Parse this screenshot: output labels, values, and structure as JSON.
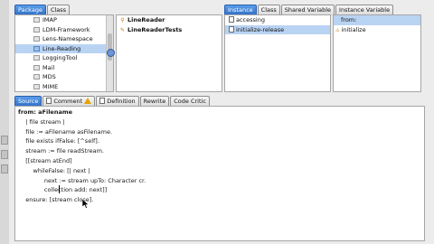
{
  "top_tabs_left": {
    "tabs": [
      {
        "label": "Package",
        "active": true
      },
      {
        "label": "Class",
        "active": false
      }
    ]
  },
  "packages": [
    {
      "label": "IMAP",
      "selected": false
    },
    {
      "label": "LDM-Framework",
      "selected": false
    },
    {
      "label": "Lens-Namespace",
      "selected": false
    },
    {
      "label": "Line-Reading",
      "selected": true
    },
    {
      "label": "LoggingTool",
      "selected": false
    },
    {
      "label": "Mail",
      "selected": false
    },
    {
      "label": "MDS",
      "selected": false
    },
    {
      "label": "MIME",
      "selected": false
    }
  ],
  "classes": [
    {
      "label": "LineReader",
      "selected": true
    },
    {
      "label": "LineReaderTests",
      "selected": false
    }
  ],
  "top_tabs_right": {
    "tabs": [
      {
        "label": "Instance",
        "active": true
      },
      {
        "label": "Class",
        "active": false
      },
      {
        "label": "Shared Variable",
        "active": false
      },
      {
        "label": "Instance Variable",
        "active": false
      }
    ]
  },
  "protocols": [
    {
      "label": "accessing",
      "selected": false
    },
    {
      "label": "initialize-release",
      "selected": true
    }
  ],
  "methods": [
    {
      "label": "from:",
      "selected": true
    },
    {
      "label": "initialize",
      "selected": false
    }
  ],
  "code_tabs": {
    "tabs": [
      {
        "label": "Source",
        "active": true
      },
      {
        "label": "Comment",
        "active": false
      },
      {
        "label": "Definition",
        "active": false
      },
      {
        "label": "Rewrite",
        "active": false
      },
      {
        "label": "Code Critic",
        "active": false
      }
    ]
  },
  "code_lines": [
    "from: aFilename",
    "    | file stream |",
    "    file := aFilename asFilename.",
    "    file exists ifFalse: [^self].",
    "    stream := file readStream.",
    "    [[stream atEnd]",
    "        whileFalse: [| next |",
    "              next := stream upTo: Character cr.",
    "              collection add: next]]",
    "    ensure: [stream close]."
  ]
}
